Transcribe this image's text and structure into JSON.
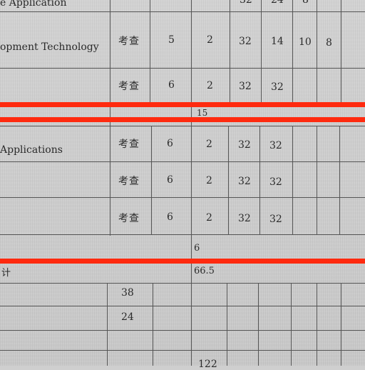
{
  "rows": [
    {
      "name": "e Application",
      "assess": "",
      "credits": "",
      "v1": "",
      "v2": "32",
      "v3": "24",
      "v4": "8",
      "v5": ""
    },
    {
      "name": "opment Technology",
      "assess": "考查",
      "credits": "5",
      "v1": "2",
      "v2": "32",
      "v3": "14",
      "v4": "10",
      "v5": "8"
    },
    {
      "name": "",
      "assess": "考查",
      "credits": "6",
      "v1": "2",
      "v2": "32",
      "v3": "32",
      "v4": "",
      "v5": ""
    },
    {
      "name": "Applications",
      "assess": "考查",
      "credits": "6",
      "v1": "2",
      "v2": "32",
      "v3": "32",
      "v4": "",
      "v5": ""
    },
    {
      "name": "",
      "assess": "考查",
      "credits": "6",
      "v1": "2",
      "v2": "32",
      "v3": "32",
      "v4": "",
      "v5": ""
    },
    {
      "name": "",
      "assess": "考查",
      "credits": "6",
      "v1": "2",
      "v2": "32",
      "v3": "32",
      "v4": "",
      "v5": ""
    }
  ],
  "subtotal_a": "15",
  "subtotal_b": "6",
  "total_label": "计",
  "total_value": "66.5",
  "other_rows": [
    "38",
    "24"
  ],
  "bottom_partial": "122"
}
